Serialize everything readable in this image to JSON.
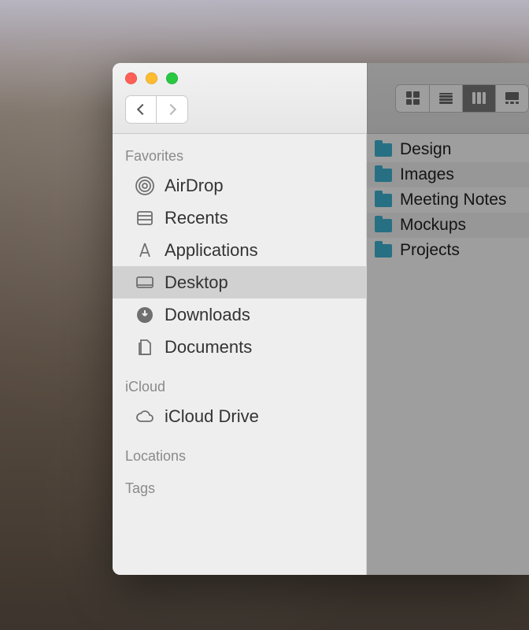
{
  "sidebar": {
    "sections": {
      "favorites": {
        "label": "Favorites",
        "items": [
          {
            "id": "airdrop",
            "label": "AirDrop"
          },
          {
            "id": "recents",
            "label": "Recents"
          },
          {
            "id": "applications",
            "label": "Applications"
          },
          {
            "id": "desktop",
            "label": "Desktop",
            "selected": true
          },
          {
            "id": "downloads",
            "label": "Downloads"
          },
          {
            "id": "documents",
            "label": "Documents"
          }
        ]
      },
      "icloud": {
        "label": "iCloud",
        "items": [
          {
            "id": "icloud-drive",
            "label": "iCloud Drive"
          }
        ]
      },
      "locations": {
        "label": "Locations",
        "items": []
      },
      "tags": {
        "label": "Tags",
        "items": []
      }
    }
  },
  "content": {
    "items": [
      {
        "name": "Design",
        "kind": "folder"
      },
      {
        "name": "Images",
        "kind": "folder"
      },
      {
        "name": "Meeting Notes",
        "kind": "folder"
      },
      {
        "name": "Mockups",
        "kind": "folder"
      },
      {
        "name": "Projects",
        "kind": "folder"
      }
    ]
  },
  "toolbar": {
    "view_mode": "column",
    "nav_back_enabled": true,
    "nav_forward_enabled": false
  },
  "colors": {
    "folder": "#3fb5d3",
    "sidebar_bg": "#eeeeee",
    "selected_bg": "#d1d1d1"
  }
}
